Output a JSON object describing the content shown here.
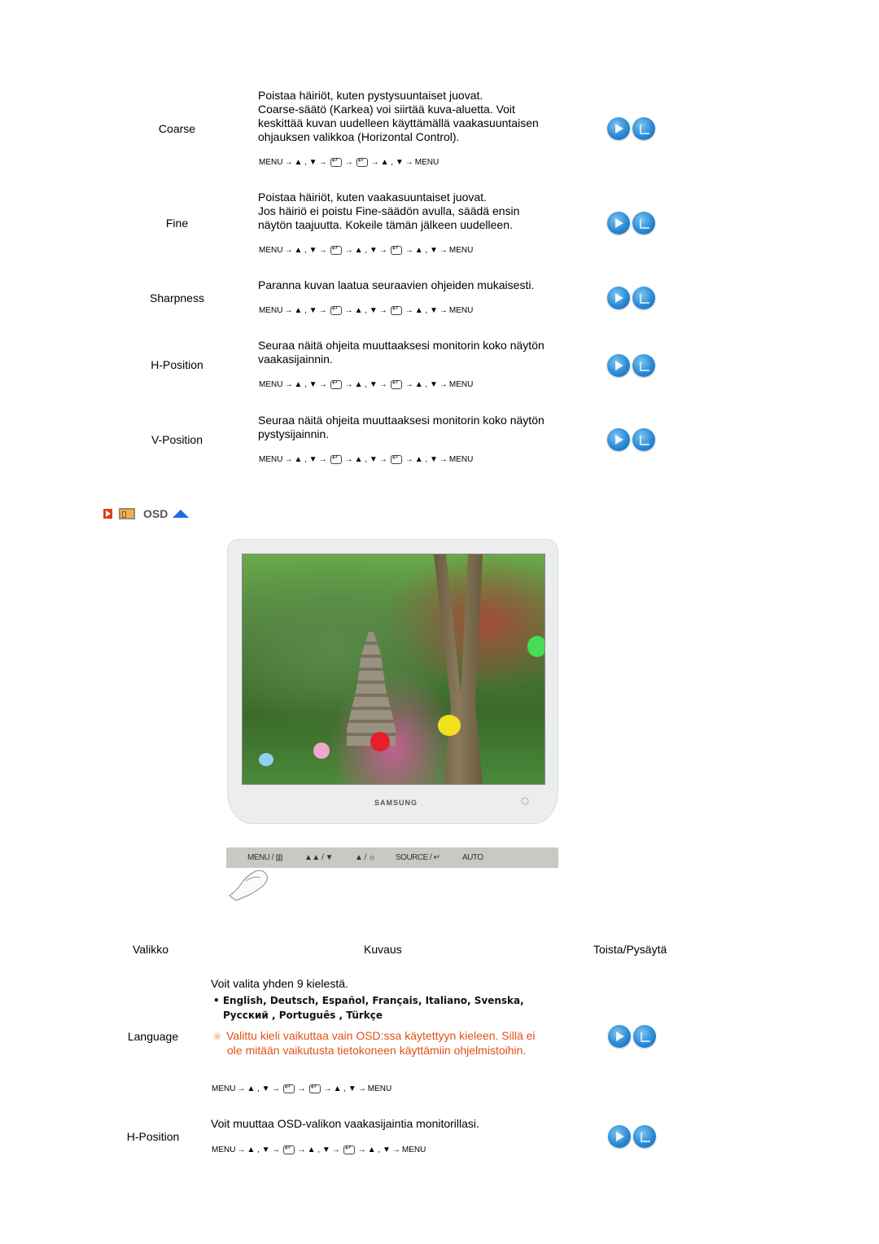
{
  "picture_rows": [
    {
      "label": "Coarse",
      "description": [
        "Poistaa häiriöt, kuten pystysuuntaiset juovat.",
        "Coarse-säätö (Karkea) voi siirtää kuva-aluetta. Voit",
        "keskittää kuvan uudelleen käyttämällä vaakasuuntaisen",
        "ohjauksen valikkoa (Horizontal Control)."
      ],
      "sequence": [
        "MENU",
        "→",
        "▲ , ▼",
        "→",
        "ENTER",
        "→",
        "ENTER",
        "→",
        "▲ , ▼",
        "→",
        "MENU"
      ]
    },
    {
      "label": "Fine",
      "description": [
        "Poistaa häiriöt, kuten vaakasuuntaiset juovat.",
        "Jos häiriö ei poistu Fine-säädön avulla, säädä ensin",
        "näytön taajuutta. Kokeile tämän jälkeen uudelleen."
      ],
      "sequence": [
        "MENU",
        "→",
        "▲ , ▼",
        "→",
        "ENTER",
        "→",
        "▲ , ▼",
        "→",
        "ENTER",
        "→",
        "▲ , ▼",
        "→",
        "MENU"
      ]
    },
    {
      "label": "Sharpness",
      "description": [
        "Paranna kuvan laatua seuraavien ohjeiden mukaisesti."
      ],
      "sequence": [
        "MENU",
        "→",
        "▲ , ▼",
        "→",
        "ENTER",
        "→",
        "▲ , ▼",
        "→",
        "ENTER",
        "→",
        "▲ , ▼",
        "→",
        "MENU"
      ]
    },
    {
      "label": "H-Position",
      "description": [
        "Seuraa näitä ohjeita muuttaaksesi monitorin koko näytön",
        "vaakasijainnin."
      ],
      "sequence": [
        "MENU",
        "→",
        "▲ , ▼",
        "→",
        "ENTER",
        "→",
        "▲ , ▼",
        "→",
        "ENTER",
        "→",
        "▲ , ▼",
        "→",
        "MENU"
      ]
    },
    {
      "label": "V-Position",
      "description": [
        "Seuraa näitä ohjeita muuttaaksesi monitorin koko näytön",
        "pystysijainnin."
      ],
      "sequence": [
        "MENU",
        "→",
        "▲ , ▼",
        "→",
        "ENTER",
        "→",
        "▲ , ▼",
        "→",
        "ENTER",
        "→",
        "▲ , ▼",
        "→",
        "MENU"
      ]
    }
  ],
  "osd_section": {
    "title": "OSD",
    "icons": [
      "section-arrow-icon",
      "osd-box-icon",
      "back-to-top-icon"
    ]
  },
  "monitor": {
    "brand": "SAMSUNG",
    "panel_buttons": [
      "MENU / ▥",
      "▲▲ / ▼",
      "▲ / ☼",
      "SOURCE / ↵",
      "AUTO"
    ]
  },
  "table_header": {
    "menu": "Valikko",
    "description": "Kuvaus",
    "play_stop": "Toista/Pysäytä"
  },
  "osd_rows": [
    {
      "label": "Language",
      "description": [
        "Voit valita yhden 9 kielestä."
      ],
      "languages_line1": "• English, Deutsch, Español, Français,  Italiano, Svenska,",
      "languages_line2": "Русский , Português , Türkçe",
      "note_mark": "※",
      "note": [
        "Valittu kieli vaikuttaa vain OSD:ssa käytettyyn kieleen. Sillä ei",
        "ole mitään vaikutusta tietokoneen käyttämiin ohjelmistoihin."
      ],
      "sequence": [
        "MENU",
        "→",
        "▲ , ▼",
        "→",
        "ENTER",
        "→",
        "ENTER",
        "→",
        "▲ , ▼",
        "→",
        "MENU"
      ]
    },
    {
      "label": "H-Position",
      "description": [
        "Voit muuttaa OSD-valikon vaakasijaintia monitorillasi."
      ],
      "sequence": [
        "MENU",
        "→",
        "▲ , ▼",
        "→",
        "ENTER",
        "→",
        "▲ , ▼",
        "→",
        "ENTER",
        "→",
        "▲ , ▼",
        "→",
        "MENU"
      ]
    }
  ],
  "buttons": {
    "play": "play",
    "stop": "stop"
  },
  "colors": {
    "note": "#e0501a",
    "button_blue": "#2a8ad6",
    "osd_up": "#1a6ee8",
    "section_arrow": "#e04010"
  }
}
